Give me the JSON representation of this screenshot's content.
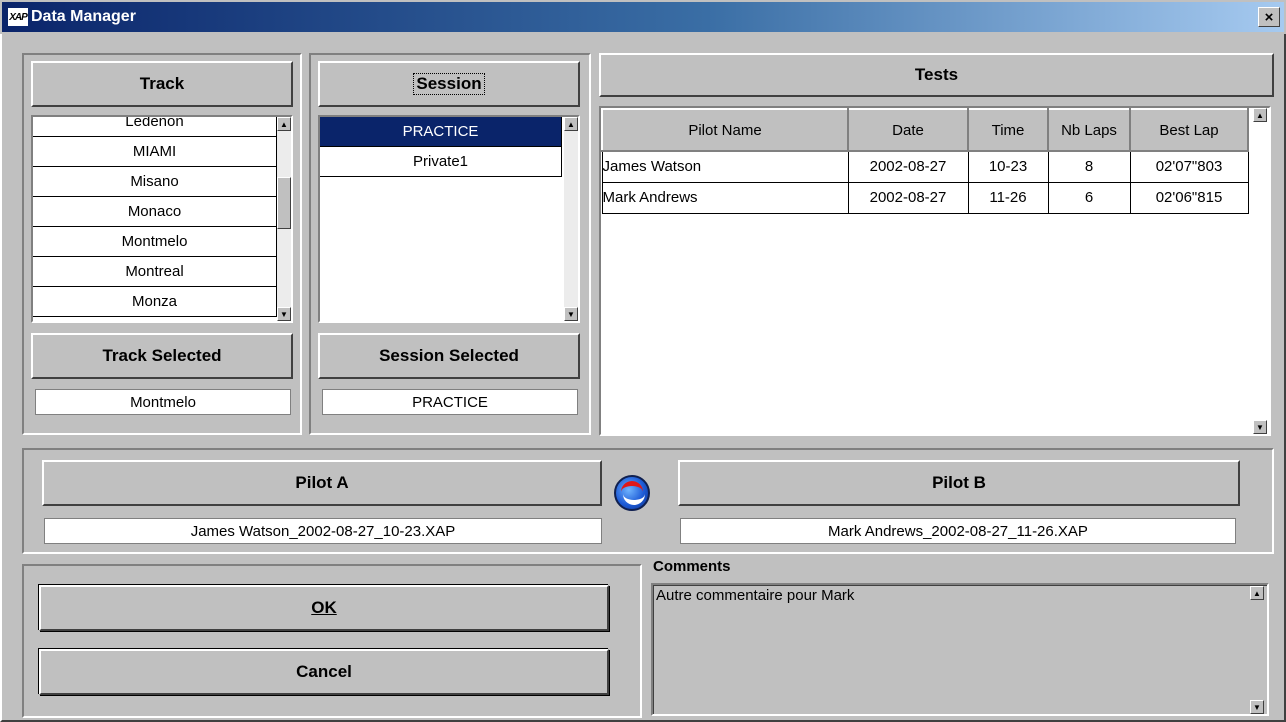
{
  "window": {
    "title": "Data Manager",
    "icon": "xap-logo-icon",
    "close": "×"
  },
  "track": {
    "header": "Track",
    "items": [
      "Ledenon",
      "MIAMI",
      "Misano",
      "Monaco",
      "Montmelo",
      "Montreal",
      "Monza"
    ],
    "selected_header": "Track Selected",
    "selected_value": "Montmelo"
  },
  "session": {
    "header": "Session",
    "items": [
      "PRACTICE",
      "Private1"
    ],
    "selected_index": 0,
    "selected_header": "Session Selected",
    "selected_value": "PRACTICE"
  },
  "tests": {
    "header": "Tests",
    "columns": [
      "Pilot Name",
      "Date",
      "Time",
      "Nb Laps",
      "Best Lap"
    ],
    "rows": [
      [
        "James Watson",
        "2002-08-27",
        "10-23",
        "8",
        "02'07\"803"
      ],
      [
        "Mark Andrews",
        "2002-08-27",
        "11-26",
        "6",
        "02'06\"815"
      ]
    ]
  },
  "pilots": {
    "a_header": "Pilot A",
    "a_file": "James Watson_2002-08-27_10-23.XAP",
    "b_header": "Pilot B",
    "b_file": "Mark Andrews_2002-08-27_11-26.XAP",
    "swap_icon": "swap-arrows-icon"
  },
  "buttons": {
    "ok": "OK",
    "cancel": "Cancel"
  },
  "comments": {
    "label": "Comments",
    "text": "Autre commentaire pour Mark"
  },
  "colors": {
    "title_start": "#0a246a",
    "title_end": "#a6caf0",
    "selection": "#0a246a",
    "face": "#c0c0c0"
  }
}
